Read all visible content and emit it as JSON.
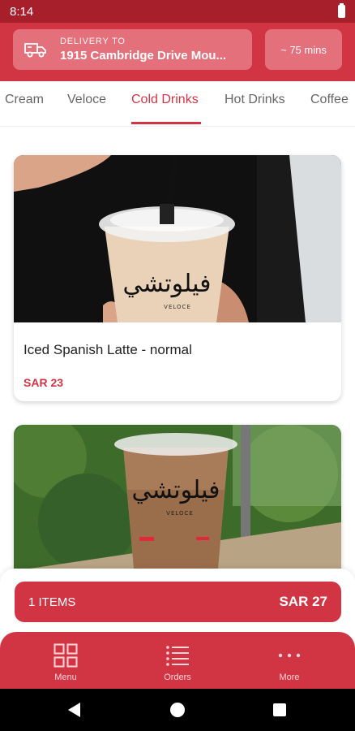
{
  "status_bar": {
    "time": "8:14"
  },
  "header": {
    "delivery_label": "DELIVERY TO",
    "delivery_address": "1915 Cambridge Drive Mou...",
    "eta": "~ 75 mins"
  },
  "tabs": {
    "items": [
      "Cream",
      "Veloce",
      "Cold Drinks",
      "Hot Drinks",
      "Coffee"
    ],
    "active": "Cold Drinks"
  },
  "products": [
    {
      "name": "Iced Spanish Latte - normal",
      "price": "SAR 23",
      "cup_text": "فيلوتشي",
      "cup_brand": "VELOCE"
    },
    {
      "name": "",
      "price": "",
      "cup_text": "فيلوتشي",
      "cup_brand": "VELOCE"
    }
  ],
  "cart": {
    "count_label": "1 ITEMS",
    "total": "SAR 27"
  },
  "bottom_nav": {
    "menu": "Menu",
    "orders": "Orders",
    "more": "More"
  },
  "colors": {
    "brand_red": "#d13544",
    "status_red": "#a81f2c"
  },
  "icons": [
    "truck-icon",
    "grid-icon",
    "list-icon",
    "dots-icon",
    "back-icon",
    "home-icon",
    "recents-icon",
    "battery-icon"
  ]
}
